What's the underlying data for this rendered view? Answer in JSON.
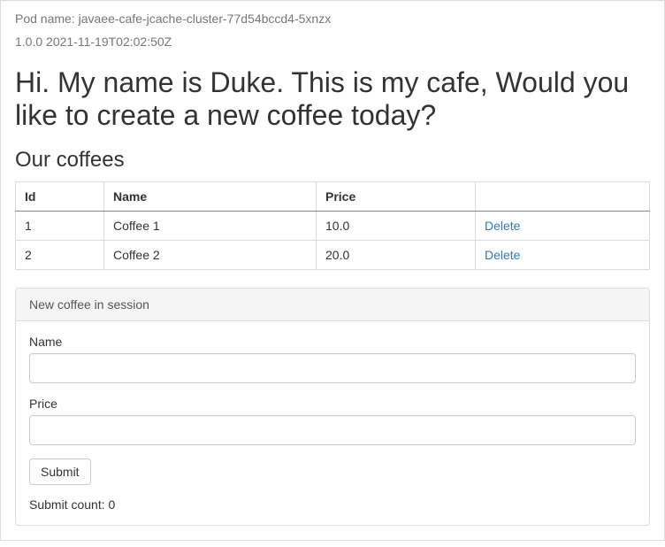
{
  "header": {
    "pod_name": "Pod name: javaee-cafe-jcache-cluster-77d54bccd4-5xnzx",
    "version_info": "1.0.0 2021-11-19T02:02:50Z"
  },
  "main": {
    "title": "Hi. My name is Duke. This is my cafe, Would you like to create a new coffee today?",
    "subtitle": "Our coffees"
  },
  "table": {
    "headers": {
      "id": "Id",
      "name": "Name",
      "price": "Price",
      "actions": ""
    },
    "rows": [
      {
        "id": "1",
        "name": "Coffee 1",
        "price": "10.0",
        "action": "Delete"
      },
      {
        "id": "2",
        "name": "Coffee 2",
        "price": "20.0",
        "action": "Delete"
      }
    ]
  },
  "form": {
    "panel_title": "New coffee in session",
    "name_label": "Name",
    "name_value": "",
    "price_label": "Price",
    "price_value": "",
    "submit_label": "Submit",
    "submit_count": "Submit count: 0"
  }
}
